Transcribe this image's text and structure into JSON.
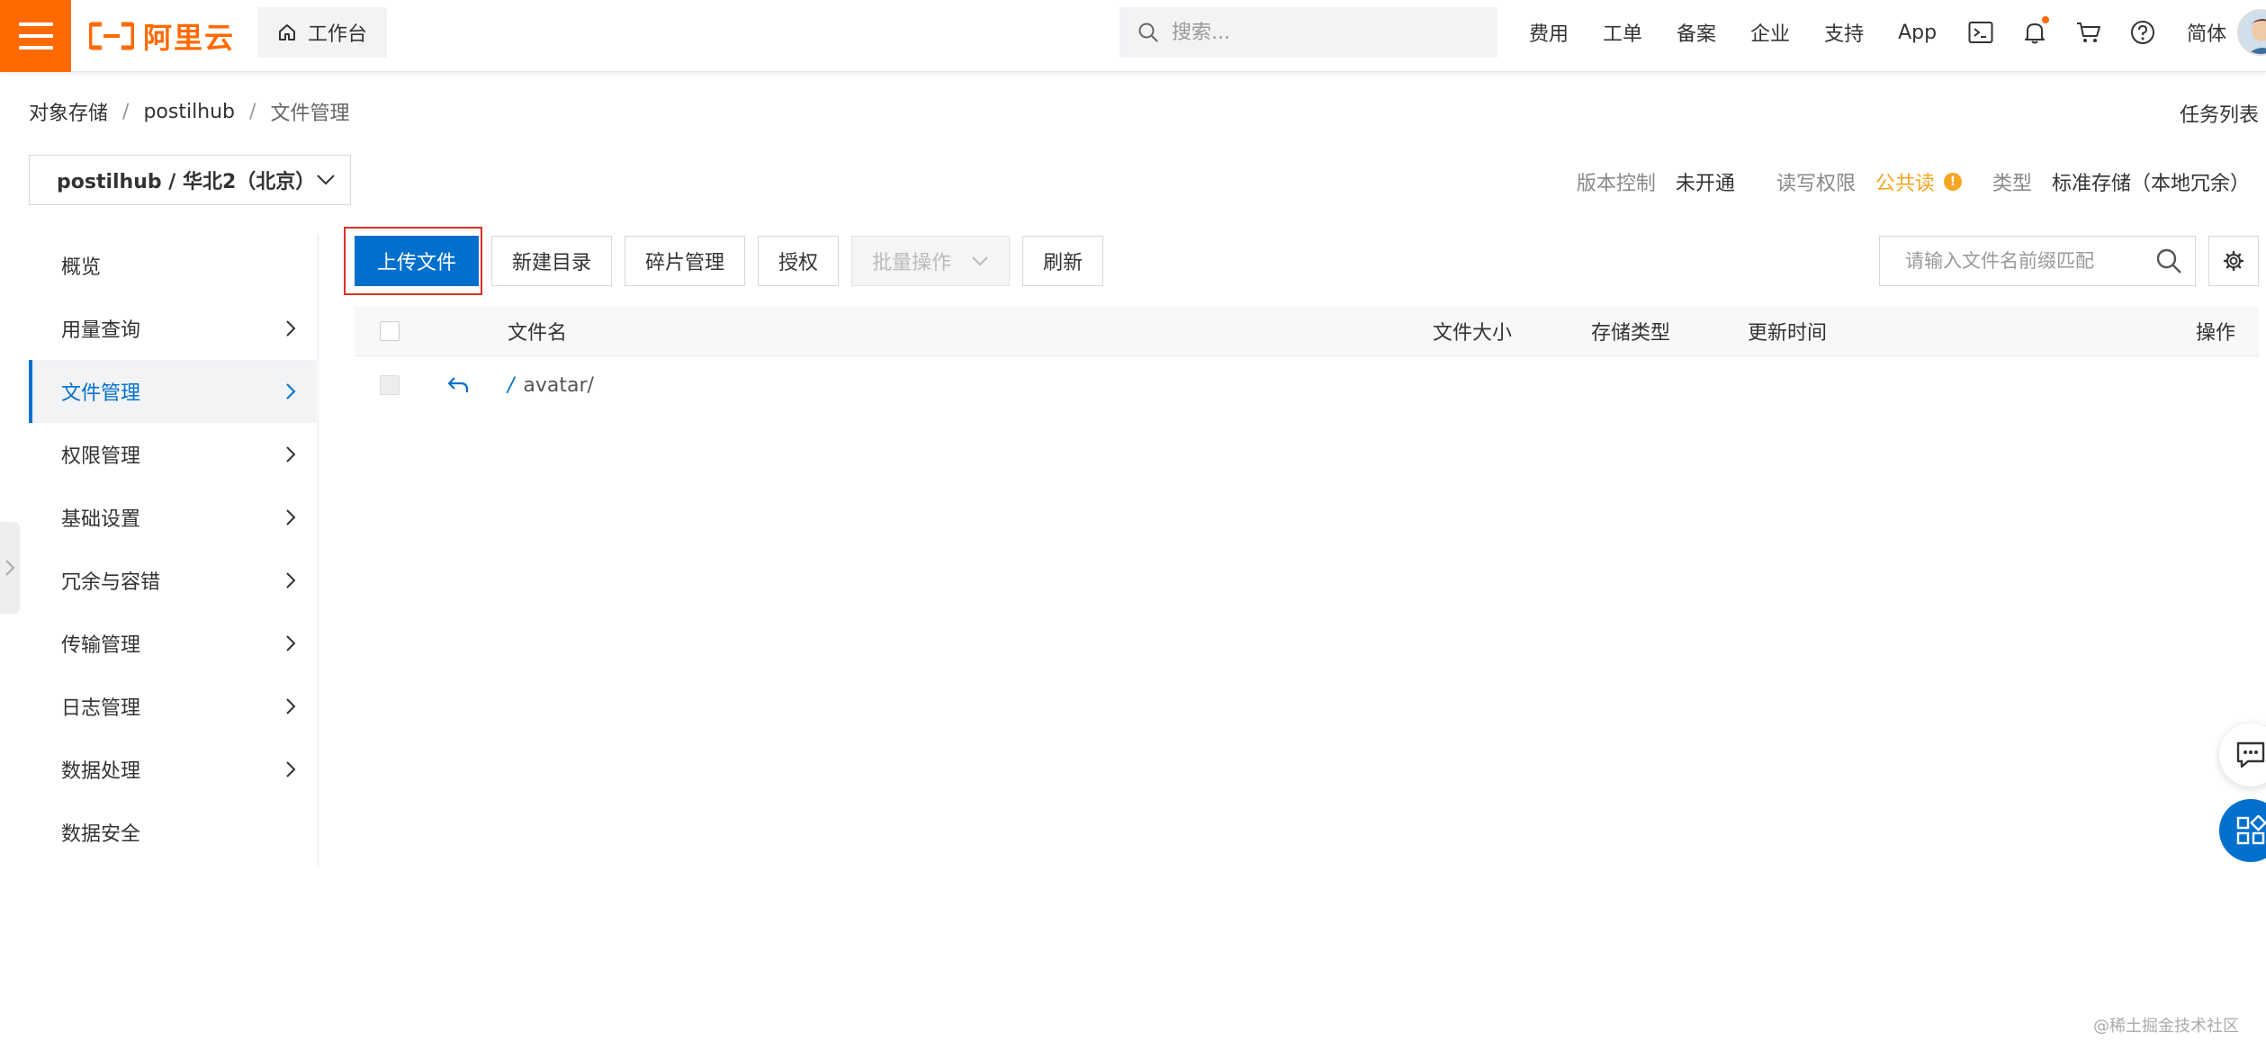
{
  "colors": {
    "brand": "#ff6a00",
    "primary": "#0070cc",
    "warning": "#f5a623",
    "highlight": "#d93026"
  },
  "topbar": {
    "logo_text": "阿里云",
    "workbench_label": "工作台",
    "search_placeholder": "搜索...",
    "links": [
      "费用",
      "工单",
      "备案",
      "企业",
      "支持",
      "App"
    ],
    "language": "简体",
    "icons": [
      "terminal-icon",
      "bell-icon",
      "cart-icon",
      "help-icon"
    ]
  },
  "breadcrumb": {
    "items": [
      "对象存储",
      "postilhub",
      "文件管理"
    ],
    "task_list": "任务列表"
  },
  "bucket": {
    "selector_label": "postilhub / 华北2（北京）",
    "version_control_label": "版本控制",
    "version_control_value": "未开通",
    "acl_label": "读写权限",
    "acl_value": "公共读",
    "type_label": "类型",
    "type_value": "标准存储（本地冗余）"
  },
  "sidebar": {
    "items": [
      {
        "label": "概览",
        "has_arrow": false,
        "active": false
      },
      {
        "label": "用量查询",
        "has_arrow": true,
        "active": false
      },
      {
        "label": "文件管理",
        "has_arrow": true,
        "active": true
      },
      {
        "label": "权限管理",
        "has_arrow": true,
        "active": false
      },
      {
        "label": "基础设置",
        "has_arrow": true,
        "active": false
      },
      {
        "label": "冗余与容错",
        "has_arrow": true,
        "active": false
      },
      {
        "label": "传输管理",
        "has_arrow": true,
        "active": false
      },
      {
        "label": "日志管理",
        "has_arrow": true,
        "active": false
      },
      {
        "label": "数据处理",
        "has_arrow": true,
        "active": false
      },
      {
        "label": "数据安全",
        "has_arrow": false,
        "active": false
      }
    ]
  },
  "toolbar": {
    "upload": "上传文件",
    "new_dir": "新建目录",
    "fragments": "碎片管理",
    "authorize": "授权",
    "batch": "批量操作",
    "refresh": "刷新",
    "file_search_placeholder": "请输入文件名前缀匹配"
  },
  "table": {
    "headers": {
      "name": "文件名",
      "size": "文件大小",
      "storage_type": "存储类型",
      "updated": "更新时间",
      "actions": "操作"
    },
    "rows": [
      {
        "name": "avatar/",
        "slash": "/"
      }
    ]
  },
  "watermark": "@稀土掘金技术社区"
}
